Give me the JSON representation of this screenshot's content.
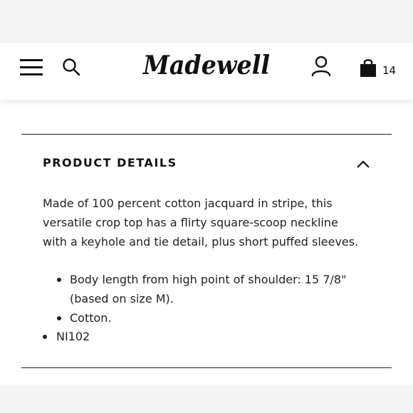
{
  "header": {
    "logo_text": "Madewell",
    "menu_icon": "hamburger-menu-icon",
    "search_icon": "search-icon",
    "account_icon": "user-account-icon",
    "bag_icon": "shopping-bag-icon",
    "bag_count": "14"
  },
  "product_details": {
    "title": "PRODUCT DETAILS",
    "toggle_icon": "chevron-up-icon",
    "description": "Made of 100 percent cotton jacquard in stripe, this versatile crop top has a flirty square-scoop neckline with a keyhole and tie detail, plus short puffed sleeves.",
    "bullets": [
      "Body length from high point of shoulder: 15 7/8\" (based on size M).",
      "Cotton."
    ],
    "sku": "NI102"
  }
}
